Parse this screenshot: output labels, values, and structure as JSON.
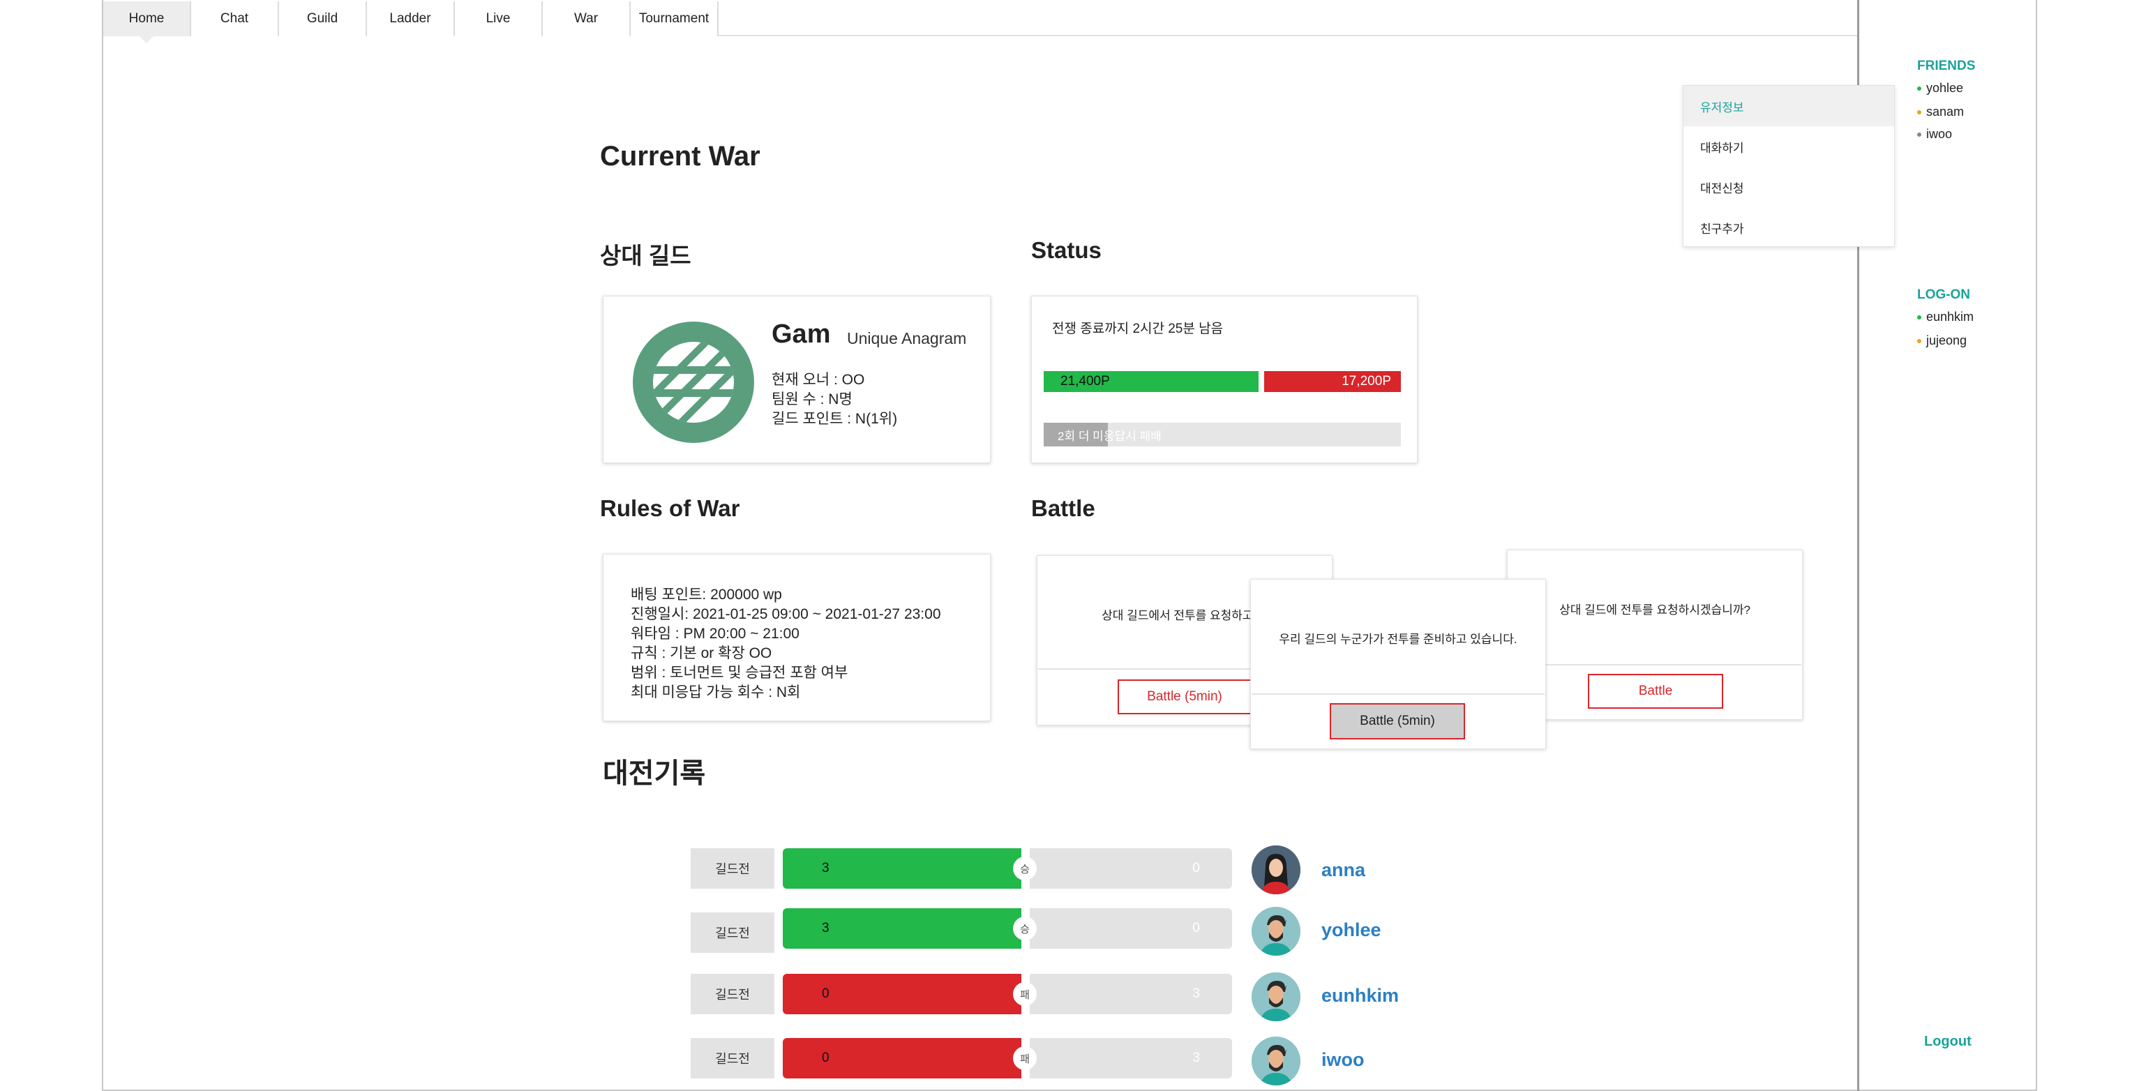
{
  "nav": {
    "tabs": [
      {
        "label": "Home"
      },
      {
        "label": "Chat"
      },
      {
        "label": "Guild"
      },
      {
        "label": "Ladder"
      },
      {
        "label": "Live"
      },
      {
        "label": "War"
      },
      {
        "label": "Tournament"
      }
    ],
    "active": "Home"
  },
  "sidebar": {
    "friends_title": "FRIENDS",
    "friends": [
      {
        "name": "yohlee",
        "status_color": "#22b84a"
      },
      {
        "name": "sanam",
        "status_color": "#f0a020"
      },
      {
        "name": "iwoo",
        "status_color": "#888888"
      }
    ],
    "logon_title": "LOG-ON",
    "logon": [
      {
        "name": "eunhkim",
        "status_color": "#22b84a"
      },
      {
        "name": "jujeong",
        "status_color": "#f0a020"
      }
    ],
    "logout_label": "Logout"
  },
  "context_menu": {
    "items": [
      "유저정보",
      "대화하기",
      "대전신청",
      "친구추가"
    ],
    "active_index": 0
  },
  "page_title": "Current War",
  "opponent": {
    "heading": "상대 길드",
    "name": "Gam",
    "subtitle": "Unique Anagram",
    "owner": "현재 오너 : OO",
    "members": "팀원 수 : N명",
    "points": "길드 포인트 : N(1위)",
    "emblem_color": "#5a9e7e"
  },
  "status": {
    "heading": "Status",
    "remaining": "전쟁 종료까지 2시간 25분 남음",
    "our_points": "21,400P",
    "their_points": "17,200P",
    "forfeit_label": "2회 더 미응답시 패배",
    "forfeit_progress": 0.18
  },
  "rules": {
    "heading": "Rules of War",
    "lines": [
      "배팅 포인트: 200000 wp",
      "진행일시: 2021-01-25 09:00 ~ 2021-01-27 23:00",
      "워타임 : PM 20:00 ~ 21:00",
      "규칙 : 기본 or 확장 OO",
      "범위 : 토너먼트 및 승급전 포함 여부",
      "최대 미응답 가능 회수 : N회"
    ]
  },
  "battle": {
    "heading": "Battle",
    "card1": {
      "text": "상대 길드에서 전투를 요청하고 있",
      "button": "Battle (5min)"
    },
    "card2": {
      "text": "우리 길드의 누군가가 전투를 준비하고 있습니다.",
      "button": "Battle (5min)"
    },
    "card3": {
      "text": "상대 길드에 전투를 요청하시겠습니까?",
      "button": "Battle"
    }
  },
  "records": {
    "heading": "대전기록",
    "rows": [
      {
        "type": "길드전",
        "left": "3",
        "result": "승",
        "right": "0",
        "win": true,
        "name": "anna"
      },
      {
        "type": "길드전",
        "left": "3",
        "result": "승",
        "right": "0",
        "win": true,
        "name": "yohlee"
      },
      {
        "type": "길드전",
        "left": "0",
        "result": "패",
        "right": "3",
        "win": false,
        "name": "eunhkim"
      },
      {
        "type": "길드전",
        "left": "0",
        "result": "패",
        "right": "3",
        "win": false,
        "name": "iwoo"
      }
    ]
  }
}
